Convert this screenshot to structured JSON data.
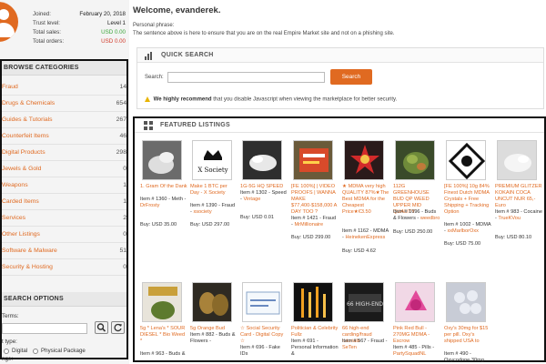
{
  "profile": {
    "stats": [
      {
        "key": "Joined:",
        "value": "February 20, 2018",
        "color": "normal"
      },
      {
        "key": "Trust level:",
        "value": "Level 1",
        "color": "normal"
      },
      {
        "key": "Total sales:",
        "value": "USD 0.00",
        "color": "green"
      },
      {
        "key": "Total orders:",
        "value": "USD 0.00",
        "color": "red"
      }
    ]
  },
  "browse": {
    "title": "BROWSE CATEGORIES",
    "items": [
      {
        "name": "Fraud",
        "count": "14"
      },
      {
        "name": "Drugs & Chemicals",
        "count": "654"
      },
      {
        "name": "Guides & Tutorials",
        "count": "267"
      },
      {
        "name": "Counterfeit Items",
        "count": "46"
      },
      {
        "name": "Digital Products",
        "count": "298"
      },
      {
        "name": "Jewels & Gold",
        "count": "0"
      },
      {
        "name": "Weapons",
        "count": "1"
      },
      {
        "name": "Carded Items",
        "count": "1"
      },
      {
        "name": "Services",
        "count": "2"
      },
      {
        "name": "Other Listings",
        "count": "0"
      },
      {
        "name": "Software & Malware",
        "count": "51"
      },
      {
        "name": "Security & Hosting",
        "count": "0"
      }
    ]
  },
  "search_options": {
    "title": "SEARCH OPTIONS",
    "terms_label": "Terms:",
    "type_label": "t type:",
    "digital_label": "Digital",
    "physical_label": "Physical Package",
    "range_label": "nge:"
  },
  "header": {
    "welcome": "Welcome, evanderek.",
    "phrase_label": "Personal phrase:",
    "phrase_text": "The sentence above is here to ensure that you are on the real Empire Market site and not on a phishing site."
  },
  "quick_search": {
    "title": "QUICK SEARCH",
    "search_label": "Search:",
    "input_value": "",
    "button_label": "Search",
    "warning_bold": "We highly recommend",
    "warning_rest": " that you disable Javascript when viewing the marketplace for better security."
  },
  "featured": {
    "title": "FEATURED LISTINGS",
    "row1": [
      {
        "title": "1. Gram Of the Dank",
        "meta": "Item # 1360 - Meth -",
        "vendor": "DrFrosty",
        "buy": "Buy: USD 35.00"
      },
      {
        "title": "Make 1 BTC per Day - X Society",
        "meta": "Item # 1390 - Fraud -",
        "vendor": "xsociety",
        "buy": "Buy: USD 297.00"
      },
      {
        "title": "1G-5G HQ SPEED",
        "meta": "Item # 1302 - Speed -",
        "vendor": "Vintage",
        "buy": "Buy: USD 0.01"
      },
      {
        "title": "[FE 100%] | VIDEO PROOFS | WANNA MAKE $77,400-$158,000 A DAY TOO ?",
        "meta": "Item # 1421 - Fraud -",
        "vendor": "MrMillionaire",
        "buy": "Buy: USD 299.00"
      },
      {
        "title": "★ MDMA very high QUALITY 87%★The Best MDMA for the Cheapest Price★€3.50",
        "meta": "Item # 1162 - MDMA -",
        "vendor": "HeinekenExpress",
        "buy": "Buy: USD 4.62"
      },
      {
        "title": "112G GREENHOUSE BUD QP WEED UPPER MID QUALITY",
        "meta": "Item # 1096 - Buds & Flowers -",
        "vendor": "weedbro",
        "buy": "Buy: USD 250.00"
      },
      {
        "title": "[FE 100%] 10g 84% Finest Dutch MDMA Crystals + Free Shipping + Tracking Option",
        "meta": "Item # 1002 - MDMA -",
        "vendor": "xxMarlborOxx",
        "buy": "Buy: USD 75.00"
      },
      {
        "title": "PREMIUM GLITZER KOKAIN COCA UNCUT NUR 65,- Euro",
        "meta": "Item # 983 - Cocaine -",
        "vendor": "TrueKVou",
        "buy": "Buy: USD 80.10"
      }
    ],
    "row2": [
      {
        "title": "5g * Lena's * SOUR DIESEL * Bio Weed *",
        "meta": "Item # 963 - Buds &"
      },
      {
        "title": "5g Orange Bud",
        "meta": "Item # 882 - Buds & Flowers -"
      },
      {
        "title": "☆ Social Security Card - Digital Copy ☆",
        "meta": "Item # 696 - Fake IDs"
      },
      {
        "title": "Politician & Celebrity Fullz",
        "meta": "Item # 691 - Personal Information &"
      },
      {
        "title": "66 high-end carding/fraud tutorials",
        "meta": "Item # 567 - Fraud -",
        "vendor": "SeTen"
      },
      {
        "title": "Pink Red Bull - 270MG MDMA - Escrow",
        "meta": "Item # 485 - Pills -",
        "vendor": "PartySquadNL"
      },
      {
        "title": "Oxy's 30mg for $15 per pill. Oxy's shipped USA to",
        "meta": "Item # 490 - Oxycodone 30mg"
      }
    ]
  },
  "colors": {
    "accent": "#e06a21",
    "green": "#3aa63a",
    "red": "#d03a2a"
  }
}
